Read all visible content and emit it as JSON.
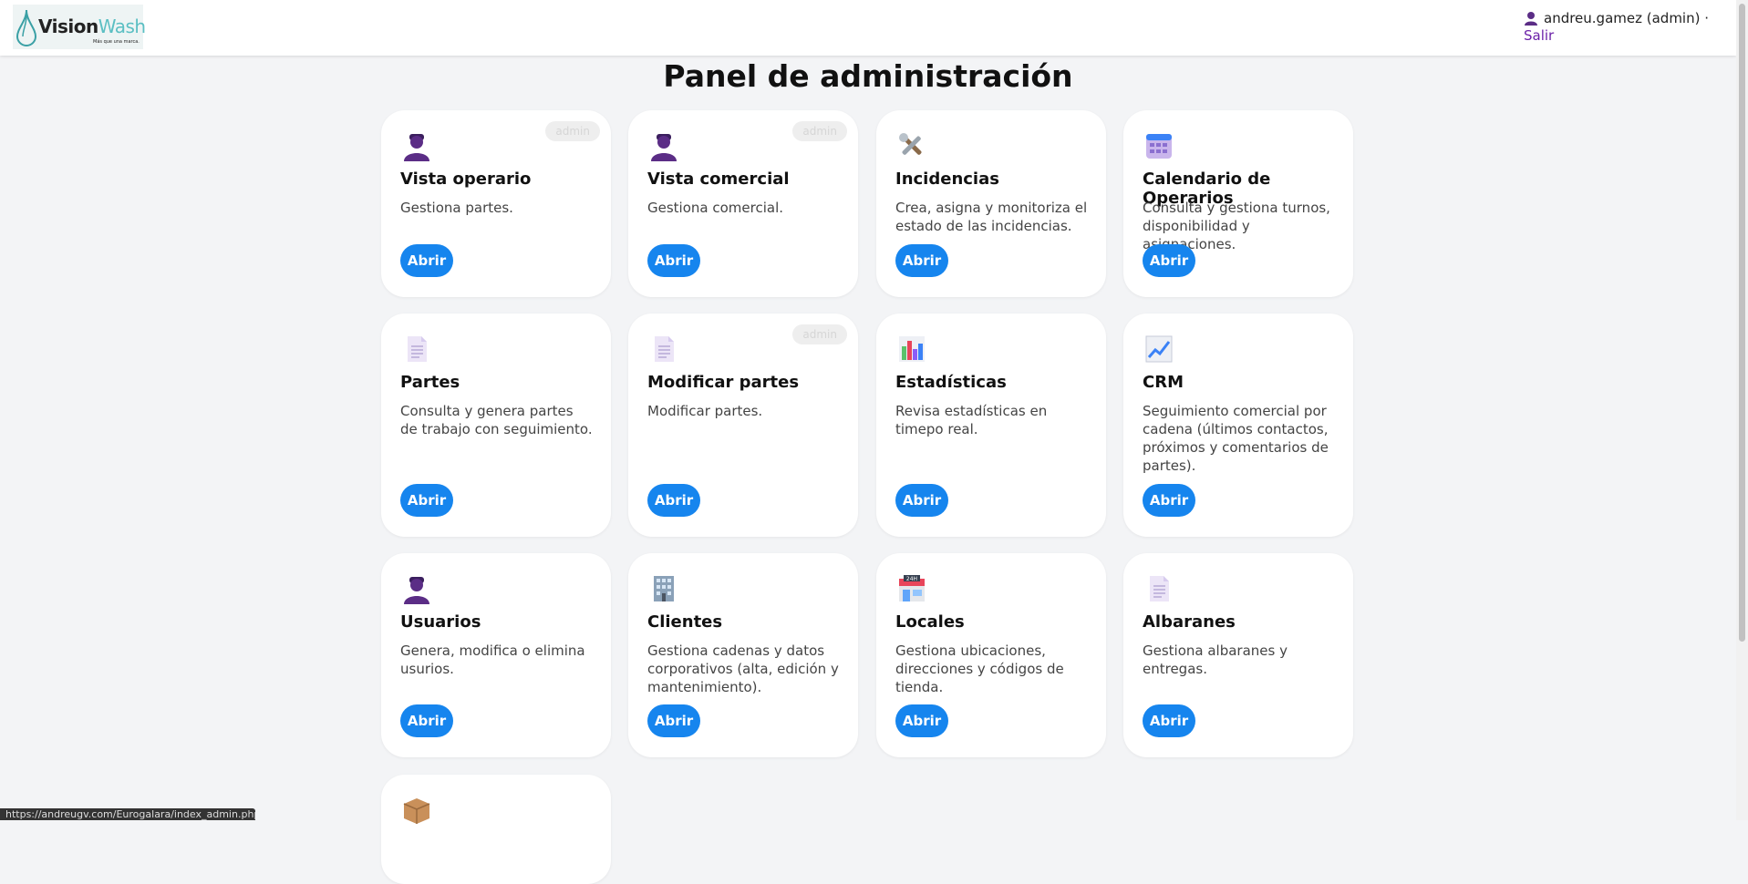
{
  "header": {
    "logo_name": "Vision",
    "logo_name_accent": "Wash",
    "logo_tagline": "Más que una marca.",
    "user_label": "andreu.gamez (admin) ·",
    "logout_label": "Salir"
  },
  "page": {
    "title": "Panel de administración"
  },
  "cards": [
    {
      "icon": "worker-icon",
      "title": "Vista operario",
      "desc": "Gestiona partes.",
      "button": "Abrir",
      "badge": "admin"
    },
    {
      "icon": "worker-icon",
      "title": "Vista comercial",
      "desc": "Gestiona comercial.",
      "button": "Abrir",
      "badge": "admin"
    },
    {
      "icon": "tools-icon",
      "title": "Incidencias",
      "desc": "Crea, asigna y monitoriza el estado de las incidencias.",
      "button": "Abrir",
      "badge": ""
    },
    {
      "icon": "calendar-icon",
      "title": "Calendario de Operarios",
      "desc": "Consulta y gestiona turnos, disponibilidad y asignaciones.",
      "button": "Abrir",
      "badge": ""
    },
    {
      "icon": "document-icon",
      "title": "Partes",
      "desc": "Consulta y genera partes de trabajo con seguimiento.",
      "button": "Abrir",
      "badge": ""
    },
    {
      "icon": "document-icon",
      "title": "Modificar partes",
      "desc": "Modificar partes.",
      "button": "Abrir",
      "badge": "admin"
    },
    {
      "icon": "bar-chart-icon",
      "title": "Estadísticas",
      "desc": "Revisa estadísticas en timepo real.",
      "button": "Abrir",
      "badge": ""
    },
    {
      "icon": "line-chart-icon",
      "title": "CRM",
      "desc": "Seguimiento comercial por cadena (últimos contactos, próximos y comentarios de partes).",
      "button": "Abrir",
      "badge": ""
    },
    {
      "icon": "worker-icon",
      "title": "Usuarios",
      "desc": "Genera, modifica o elimina usurios.",
      "button": "Abrir",
      "badge": ""
    },
    {
      "icon": "office-building-icon",
      "title": "Clientes",
      "desc": "Gestiona cadenas y datos corporativos (alta, edición y mantenimiento).",
      "button": "Abrir",
      "badge": ""
    },
    {
      "icon": "store-24h-icon",
      "title": "Locales",
      "desc": "Gestiona ubicaciones, direcciones y códigos de tienda.",
      "button": "Abrir",
      "badge": ""
    },
    {
      "icon": "document-icon",
      "title": "Albaranes",
      "desc": "Gestiona albaranes y entregas.",
      "button": "Abrir",
      "badge": ""
    },
    {
      "icon": "package-icon",
      "title": "",
      "desc": "",
      "button": "",
      "badge": ""
    }
  ],
  "status_url": "https://andreugv.com/Eurogalara/index_admin.php"
}
